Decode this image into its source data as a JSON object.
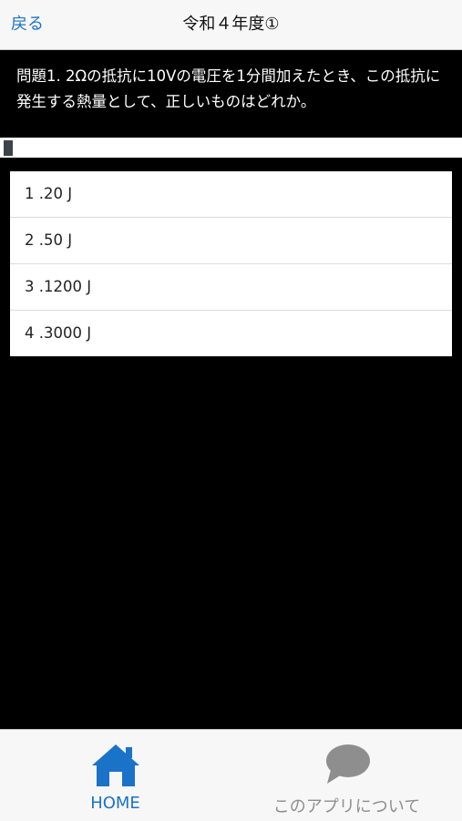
{
  "navbar": {
    "back_label": "戻る",
    "title": "令和４年度①"
  },
  "question": {
    "text": "問題1. 2Ωの抵抗に10Vの電圧を1分間加えたとき、この抵抗に発生する熱量として、正しいものはどれか。",
    "progress": 0.02
  },
  "options": [
    {
      "label": "1 .20 J"
    },
    {
      "label": "2 .50 J"
    },
    {
      "label": "3 .1200 J"
    },
    {
      "label": "4 .3000 J"
    }
  ],
  "tabbar": {
    "items": [
      {
        "label": "HOME",
        "icon": "home-icon",
        "color": "#1a73c9"
      },
      {
        "label": "このアプリについて",
        "icon": "speech-bubble-icon",
        "color": "#8e8e8e"
      }
    ]
  }
}
